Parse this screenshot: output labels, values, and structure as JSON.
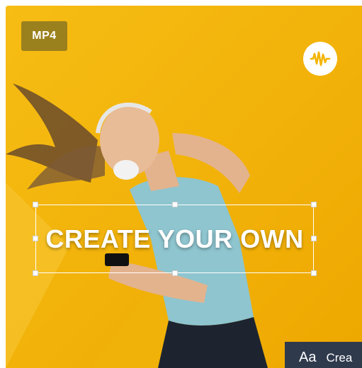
{
  "template_card": {
    "format_badge": "MP4",
    "headline_text": "CREATE YOUR OWN",
    "brand_icon": "soundwave-icon",
    "bottom_bar": {
      "font_icon_label": "Aa",
      "label": "Crea"
    }
  },
  "colors": {
    "background_yellow": "#f4b400",
    "badge_bg": "#5a5a34",
    "text_white": "#ffffff",
    "bar_dark": "#2f3a4d"
  }
}
